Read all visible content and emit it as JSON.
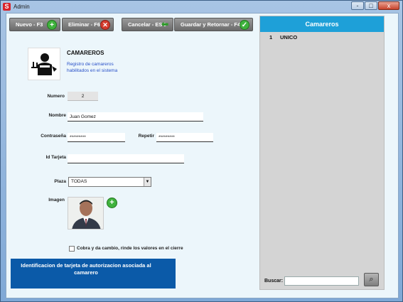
{
  "window": {
    "title": "Admin",
    "app_icon": "S",
    "close_label": "x",
    "minimize_label": "-",
    "maximize_label": "□"
  },
  "toolbar": {
    "new_label": "Nuevo - F3",
    "delete_label": "Eliminar - F6",
    "cancel_label": "Cancelar - ESC",
    "save_label": "Guardar y Retornar - F4"
  },
  "header": {
    "title": "CAMAREROS",
    "description": "Registro de camareros habilitados en el sistema"
  },
  "form": {
    "numero_label": "Numero",
    "numero_value": "2",
    "nombre_label": "Nombre",
    "nombre_value": "Juan Gomez",
    "contrasena_label": "Contraseña",
    "contrasena_value": "*********",
    "repetir_label": "Repetir",
    "repetir_value": "*********",
    "id_tarjeta_label": "Id Tarjeta",
    "id_tarjeta_value": "",
    "plaza_label": "Plaza",
    "plaza_value": "TODAS",
    "imagen_label": "Imagen",
    "checkbox_label": "Cobra y da cambio, rinde los valores en el cierre",
    "checkbox_checked": false
  },
  "info_box": {
    "text": "Identificacion de tarjeta de autorizacion asociada al camarero"
  },
  "list_panel": {
    "title": "Camareros",
    "items": [
      {
        "num": "1",
        "name": "UNICO"
      }
    ],
    "search_label": "Buscar:",
    "search_value": ""
  },
  "colors": {
    "accent": "#1ea0d8",
    "info_box": "#0b5aa8",
    "add_green": "#3fb23d",
    "delete_red": "#d33b2d"
  }
}
